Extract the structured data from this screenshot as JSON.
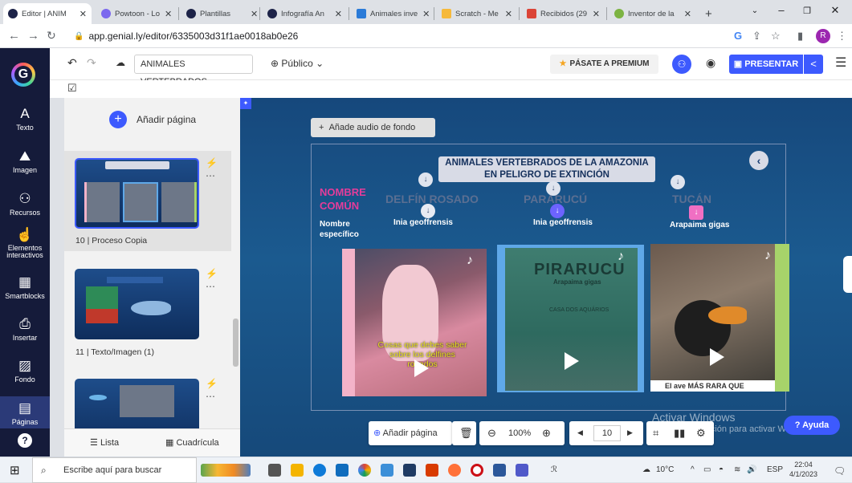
{
  "browser": {
    "tabs": [
      {
        "label": "Editor | ANIM",
        "color": "#1d2348",
        "active": true
      },
      {
        "label": "Powtoon - Lo",
        "color": "#7b68ee"
      },
      {
        "label": "Plantillas",
        "color": "#1d2348"
      },
      {
        "label": "Infografía An",
        "color": "#1d2348"
      },
      {
        "label": "Animales inve",
        "color": "#2b7bd8"
      },
      {
        "label": "Scratch - Me",
        "color": "#f6b93b"
      },
      {
        "label": "Recibidos (29",
        "color": "#db4437"
      },
      {
        "label": "Inventor de la",
        "color": "#7cb342"
      }
    ],
    "new_tab": "+",
    "url": "app.genial.ly/editor/6335003d31f1ae0018ab0e26",
    "profile_initial": "R"
  },
  "sidebar": {
    "items": [
      {
        "label": "Texto",
        "icon": "A"
      },
      {
        "label": "Imagen",
        "icon": "⛰"
      },
      {
        "label": "Recursos",
        "icon": "⚇"
      },
      {
        "label": "Elementos interactivos",
        "icon": "☝"
      },
      {
        "label": "Smartblocks",
        "icon": "▦"
      },
      {
        "label": "Insertar",
        "icon": "⎙"
      },
      {
        "label": "Fondo",
        "icon": "▨"
      },
      {
        "label": "Páginas",
        "icon": "▤"
      }
    ]
  },
  "toolbar": {
    "title": "ANIMALES VERTEBRADOS",
    "visibility": "Público",
    "premium": "PÁSATE A PREMIUM",
    "present": "PRESENTAR"
  },
  "pages_panel": {
    "add_page": "Añadir página",
    "pages": [
      {
        "label": "10 | Proceso Copia"
      },
      {
        "label": "11 | Texto/Imagen (1)"
      }
    ],
    "view_list": "Lista",
    "view_grid": "Cuadrícula"
  },
  "canvas": {
    "audio_button": "Añade audio de fondo",
    "title_line1": "ANIMALES VERTEBRADOS DE LA AMAZONIA",
    "title_line2": "EN PELIGRO DE EXTINCIÓN",
    "nombre_comun_l1": "NOMBRE",
    "nombre_comun_l2": "COMÚN",
    "nombre_especifico_l1": "Nombre",
    "nombre_especifico_l2": "específico",
    "animals": [
      {
        "common": "DELFÍN ROSADO",
        "scientific": "Inia geoffrensis"
      },
      {
        "common": "PARARUCÚ",
        "scientific": "Inia geoffrensis"
      },
      {
        "common": "TUCÁN",
        "scientific": "Arapaima gigas"
      }
    ],
    "video1_caption_l1": "Cosas que debes saber",
    "video1_caption_l2": "sobre los delfines",
    "video1_caption_l3": "rosados",
    "video2_logo": "PIRARUCU",
    "video2_sub": "Arapaima gigas",
    "video2_casa": "CASA DOS AQUÁRIOS",
    "video3_caption": "El ave MÁS RARA QUE",
    "windows_watermark_l1": "Activar Windows",
    "windows_watermark_l2": "Ve a Configuración para activar Windows.",
    "help": "Ayuda"
  },
  "bottom_bar": {
    "add_page": "Añadir página",
    "zoom": "100%",
    "page_number": "10"
  },
  "taskbar": {
    "search": "Escribe aquí para buscar",
    "weather": "10°C",
    "lang": "ESP",
    "time": "22:04",
    "date": "4/1/2023"
  },
  "colors": {
    "accent": "#3d5afe",
    "sidebar_bg": "#151b3a",
    "canvas_bg": "#1b5a8f",
    "pink": "#e53c9a"
  }
}
